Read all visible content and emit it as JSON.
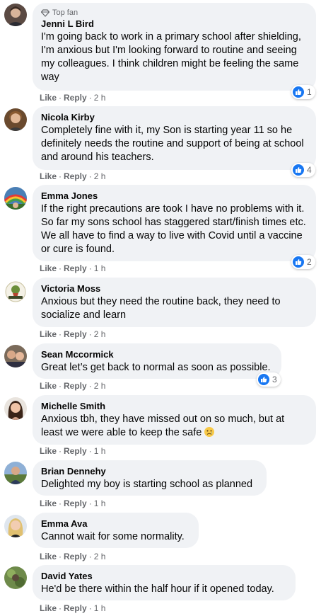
{
  "comments": [
    {
      "badge": "Top fan",
      "author": "Jenni L Bird",
      "text": "I'm going back to work in a primary school after shielding, I'm anxious but I'm looking forward to routine and seeing my colleagues. I think children might be feeling the same way",
      "like_label": "Like",
      "reply_label": "Reply",
      "time": "2 h",
      "reaction_count": "1"
    },
    {
      "author": "Nicola Kirby",
      "text": "Completely fine with it, my Son is starting year 11 so he definitely needs the routine and support of being at school and around his teachers.",
      "like_label": "Like",
      "reply_label": "Reply",
      "time": "2 h",
      "reaction_count": "4"
    },
    {
      "author": "Emma Jones",
      "text": "If the right precautions are took I have no problems with it. So far my sons school has staggered start/finish times etc. We all have to find a way to live with Covid until a vaccine or cure is found.",
      "like_label": "Like",
      "reply_label": "Reply",
      "time": "1 h",
      "reaction_count": "2"
    },
    {
      "author": "Victoria Moss",
      "text": "Anxious but they need the routine back, they need to socialize and learn",
      "like_label": "Like",
      "reply_label": "Reply",
      "time": "2 h"
    },
    {
      "author": "Sean Mccormick",
      "text": "Great let’s get back to normal as soon as possible.",
      "like_label": "Like",
      "reply_label": "Reply",
      "time": "2 h",
      "reaction_count": "3"
    },
    {
      "author": "Michelle Smith",
      "text": "Anxious tbh, they have missed out on so much, but at least we were able to keep the safe",
      "like_label": "Like",
      "reply_label": "Reply",
      "time": "1 h"
    },
    {
      "author": "Brian Dennehy",
      "text": "Delighted my boy is starting school as planned",
      "like_label": "Like",
      "reply_label": "Reply",
      "time": "1 h"
    },
    {
      "author": "Emma Ava",
      "text": "Cannot wait for some normality.",
      "like_label": "Like",
      "reply_label": "Reply",
      "time": "2 h"
    },
    {
      "author": "David Yates",
      "text": "He'd be there within the half hour if it opened today.",
      "like_label": "Like",
      "reply_label": "Reply",
      "time": "1 h"
    }
  ],
  "icons": {
    "badge": "diamond-icon",
    "reaction": "like-icon",
    "emoji": "sad-face-emoji"
  },
  "colors": {
    "bubble": "#f0f2f5",
    "like_blue": "#1877f2",
    "meta_text": "#65676b"
  }
}
